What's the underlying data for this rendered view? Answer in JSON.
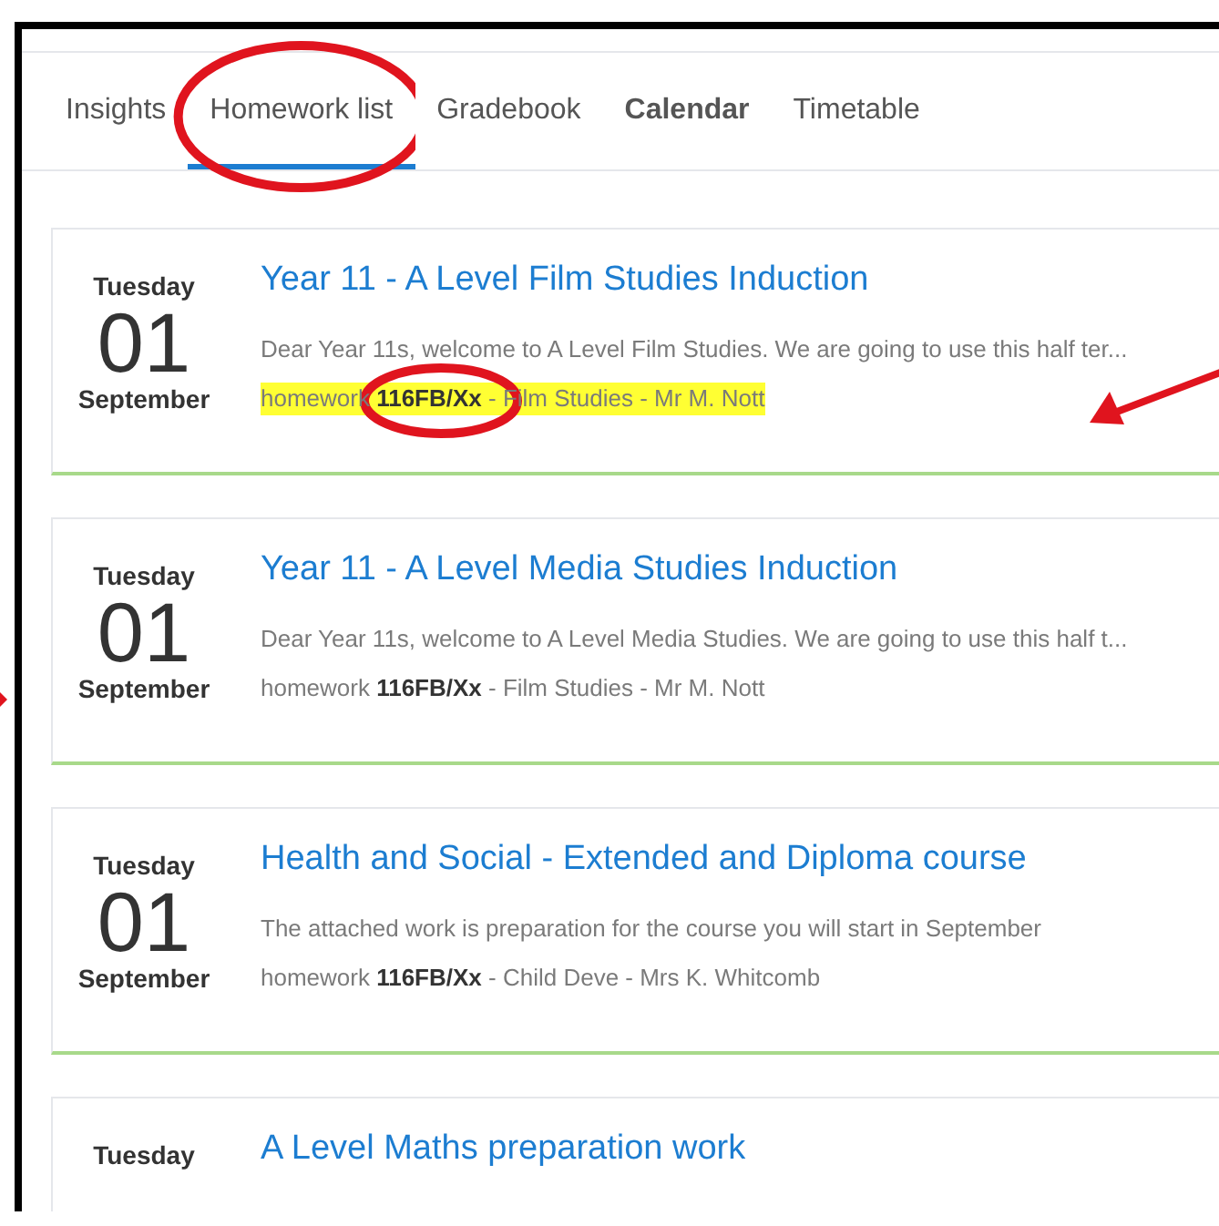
{
  "tabs": [
    {
      "label": "Insights",
      "selected": false,
      "circled": false
    },
    {
      "label": "Homework list",
      "selected": true,
      "circled": true
    },
    {
      "label": "Gradebook",
      "selected": false,
      "circled": false
    },
    {
      "label": "Calendar",
      "selected": false,
      "circled": false
    },
    {
      "label": "Timetable",
      "selected": false,
      "circled": false
    }
  ],
  "cards": [
    {
      "weekday": "Tuesday",
      "day": "01",
      "month": "September",
      "title": "Year 11 - A Level Film Studies Induction",
      "description": "Dear Year 11s, welcome to A Level Film Studies.  We are going to use this half ter...",
      "meta": "homework **116FB/Xx** - Film Studies - Mr M. Nott",
      "highlighted": true,
      "code_circled": true,
      "arrow_from_right": true,
      "arrow_from_left": false
    },
    {
      "weekday": "Tuesday",
      "day": "01",
      "month": "September",
      "title": "Year 11 - A Level Media Studies Induction",
      "description": "Dear Year 11s, welcome to A Level Media Studies.  We are going to use this half t...",
      "meta": "homework **116FB/Xx** - Film Studies - Mr M. Nott",
      "highlighted": false,
      "code_circled": false,
      "arrow_from_right": false,
      "arrow_from_left": true
    },
    {
      "weekday": "Tuesday",
      "day": "01",
      "month": "September",
      "title": "Health and Social - Extended and Diploma course",
      "description": "The attached work is preparation for the course you will start in September",
      "meta": "homework **116FB/Xx** - Child Deve - Mrs K. Whitcomb",
      "highlighted": false,
      "code_circled": false,
      "arrow_from_right": false,
      "arrow_from_left": false
    },
    {
      "weekday": "Tuesday",
      "title": "A Level Maths preparation work"
    }
  ]
}
